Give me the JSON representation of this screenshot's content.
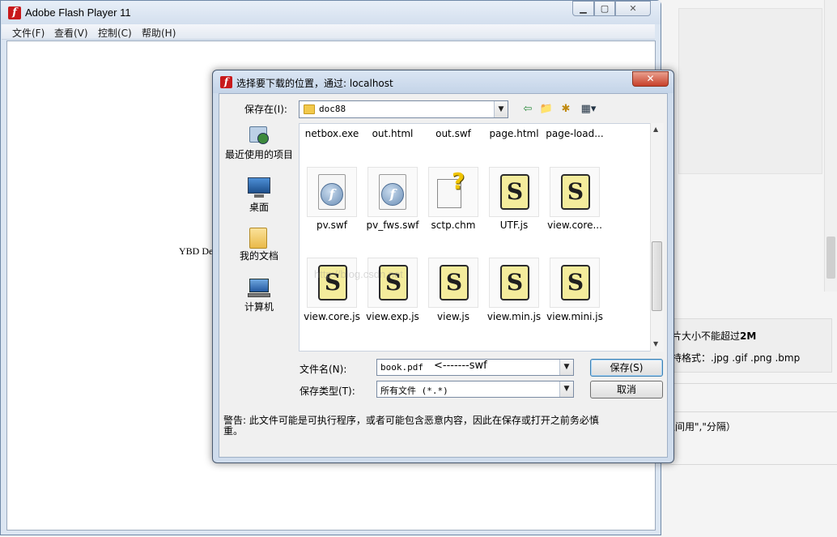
{
  "background_page": {
    "note_size": "片大小不能超过",
    "note_size_bold": "2M",
    "note_format": "持格式：.jpg .gif .png .bmp",
    "note_separator": "之间用\",\"分隔）"
  },
  "flash_window": {
    "title": "Adobe Flash Player 11",
    "menus": [
      "文件(F)",
      "查看(V)",
      "控制(C)",
      "帮助(H)"
    ],
    "content_text": "YBD De"
  },
  "dialog": {
    "title": "选择要下载的位置，通过: localhost",
    "save_in_label": "保存在(I):",
    "save_in_value": "doc88",
    "places": [
      "最近使用的项目",
      "桌面",
      "我的文档",
      "计算机"
    ],
    "files_top_row": [
      "netbox.exe",
      "out.html",
      "out.swf",
      "page.html",
      "page-load..."
    ],
    "files_row2": [
      {
        "name": "pv.swf",
        "icon": "flash-file-icon"
      },
      {
        "name": "pv_fws.swf",
        "icon": "flash-file-icon"
      },
      {
        "name": "sctp.chm",
        "icon": "chm-help-icon"
      },
      {
        "name": "UTF.js",
        "icon": "js-script-icon"
      },
      {
        "name": "view.core...",
        "icon": "js-script-icon"
      }
    ],
    "files_row3": [
      {
        "name": "view.core.js",
        "icon": "js-script-icon"
      },
      {
        "name": "view.exp.js",
        "icon": "js-script-icon"
      },
      {
        "name": "view.js",
        "icon": "js-script-icon"
      },
      {
        "name": "view.min.js",
        "icon": "js-script-icon"
      },
      {
        "name": "view.mini.js",
        "icon": "js-script-icon"
      }
    ],
    "filename_label": "文件名(N):",
    "filename_value": "book.pdf",
    "filename_annotation": "<-------swf",
    "filetype_label": "保存类型(T):",
    "filetype_value": "所有文件 (*.*)",
    "save_button": "保存(S)",
    "cancel_button": "取消",
    "warning": "警告: 此文件可能是可执行程序，或者可能包含恶意内容，因此在保存或打开之前务必慎重。",
    "watermark": "http://blog.csdn.net"
  }
}
